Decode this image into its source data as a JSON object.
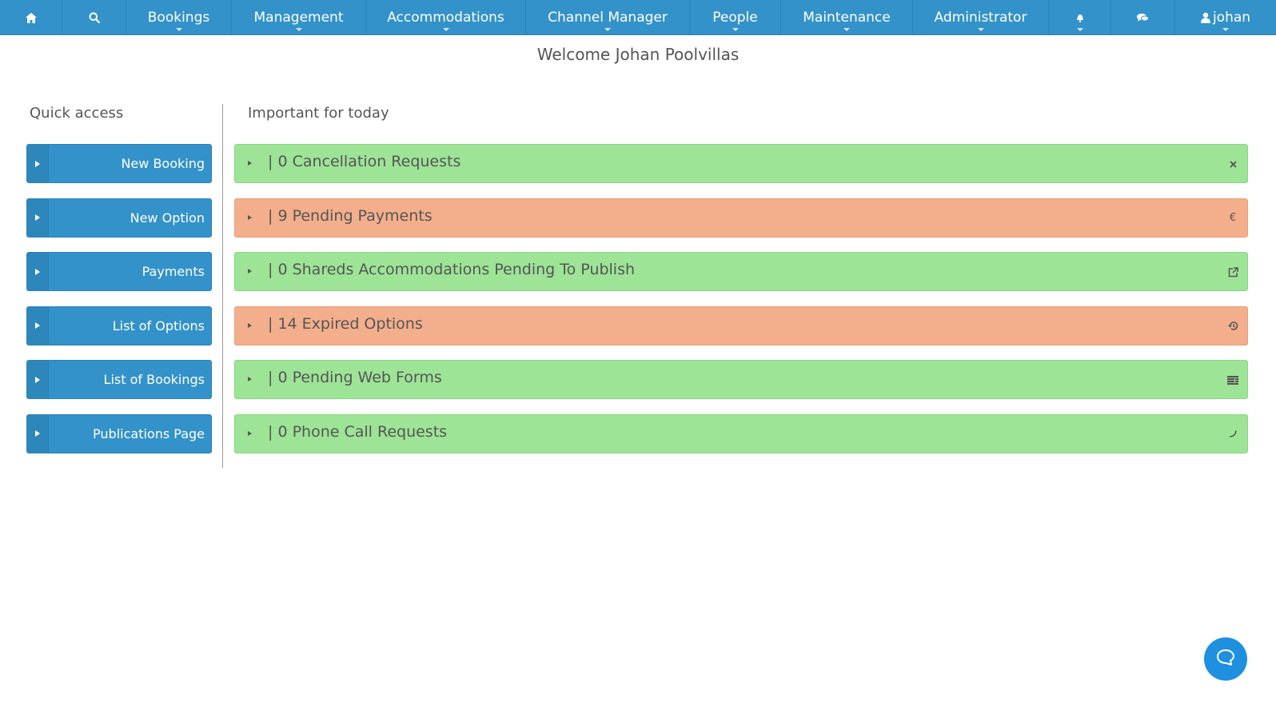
{
  "nav": {
    "home_icon": "home-icon",
    "search_icon": "search-icon",
    "items": [
      {
        "label": "Bookings"
      },
      {
        "label": "Management"
      },
      {
        "label": "Accommodations"
      },
      {
        "label": "Channel Manager"
      },
      {
        "label": "People"
      },
      {
        "label": "Maintenance"
      },
      {
        "label": "Administrator"
      }
    ],
    "bell_icon": "bell-icon",
    "chat_icon": "comments-icon",
    "user_icon": "user-icon",
    "user_label": "johan",
    "bar_color": "#3392c9"
  },
  "welcome": "Welcome Johan  Poolvillas",
  "quick_access": {
    "title": "Quick access",
    "buttons": [
      {
        "label": "New Booking"
      },
      {
        "label": "New Option"
      },
      {
        "label": "Payments"
      },
      {
        "label": "List of Options"
      },
      {
        "label": "List of Bookings"
      },
      {
        "label": "Publications Page"
      }
    ]
  },
  "important": {
    "title": "Important for today",
    "rows": [
      {
        "text": "| 0  Cancellation Requests",
        "status": "green",
        "icon": "close-icon"
      },
      {
        "text": "| 9  Pending Payments",
        "status": "orange",
        "icon": "euro-icon"
      },
      {
        "text": "| 0  Shareds Accommodations Pending To Publish",
        "status": "green",
        "icon": "external-link-icon"
      },
      {
        "text": "| 14  Expired Options",
        "status": "orange",
        "icon": "history-icon"
      },
      {
        "text": "| 0  Pending Web Forms",
        "status": "green",
        "icon": "list-icon"
      },
      {
        "text": "| 0  Phone Call Requests",
        "status": "green",
        "icon": "phone-icon"
      }
    ],
    "colors": {
      "green": "#9de496",
      "orange": "#f3ae8c"
    }
  },
  "chat_widget": {
    "icon": "chat-bubble-icon",
    "color": "#1f8fe0"
  }
}
